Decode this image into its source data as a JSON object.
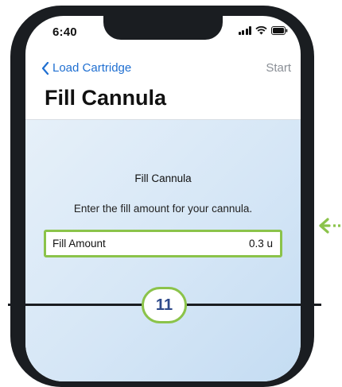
{
  "status_bar": {
    "time": "6:40"
  },
  "nav": {
    "back_label": "Load Cartridge",
    "right_label": "Start"
  },
  "page": {
    "title": "Fill Cannula"
  },
  "section": {
    "title": "Fill Cannula",
    "description": "Enter the fill amount for your cannula."
  },
  "fill_amount": {
    "label": "Fill Amount",
    "value": "0.3 u"
  },
  "step": {
    "number": "11"
  },
  "colors": {
    "accent_blue": "#1f6fd1",
    "highlight_green": "#8bc34a",
    "badge_text": "#2f4a8a"
  }
}
